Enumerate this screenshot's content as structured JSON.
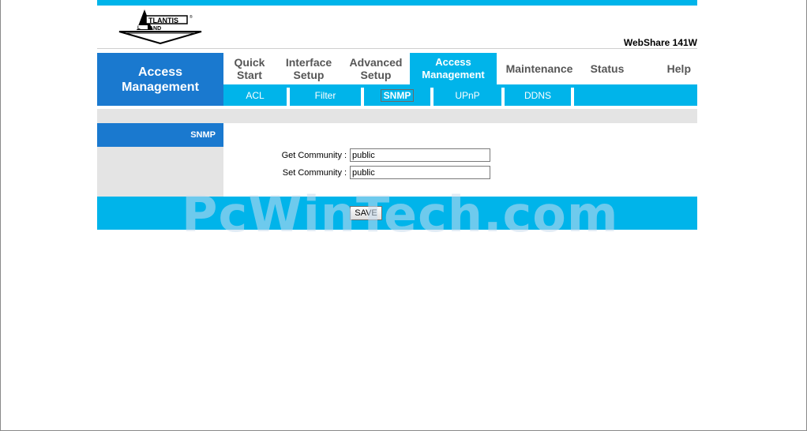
{
  "brand": {
    "model": "WebShare 141W",
    "logo_text": "ATLANTIS LAND"
  },
  "section_title": "Access Management",
  "tabs": [
    {
      "label": "Quick Start"
    },
    {
      "label": "Interface Setup"
    },
    {
      "label": "Advanced Setup"
    },
    {
      "label": "Access Management",
      "active": true
    },
    {
      "label": "Maintenance"
    },
    {
      "label": "Status"
    },
    {
      "label": "Help"
    }
  ],
  "subtabs": [
    {
      "label": "ACL"
    },
    {
      "label": "Filter"
    },
    {
      "label": "SNMP",
      "active": true
    },
    {
      "label": "UPnP"
    },
    {
      "label": "DDNS"
    }
  ],
  "left_label": "SNMP",
  "form": {
    "get_label": "Get Community",
    "get_value": "public",
    "set_label": "Set Community",
    "set_value": "public",
    "colon": ":"
  },
  "save_label": "SAVE",
  "watermark": "PcWinTech.com",
  "colors": {
    "accent": "#00b4ea",
    "section_blue": "#1a79cf",
    "grey": "#e4e4e4"
  }
}
